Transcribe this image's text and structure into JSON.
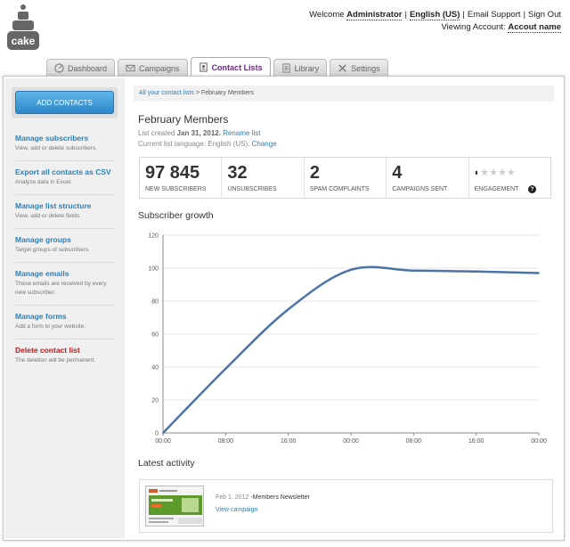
{
  "header": {
    "welcome_prefix": "Welcome",
    "user": "Administrator",
    "language": "English (US)",
    "support": "Email Support",
    "signout": "Sign Out",
    "viewing_prefix": "Viewing Account:",
    "account_name": "Accout name",
    "logo_text": "cake"
  },
  "tabs": [
    {
      "label": "Dashboard",
      "icon": "dashboard-icon"
    },
    {
      "label": "Campaigns",
      "icon": "envelope-icon"
    },
    {
      "label": "Contact Lists",
      "icon": "contact-book-icon",
      "active": true
    },
    {
      "label": "Library",
      "icon": "library-icon"
    },
    {
      "label": "Settings",
      "icon": "tools-icon"
    }
  ],
  "sidebar": {
    "add_button": "ADD CONTACTS",
    "items": [
      {
        "title": "Manage subscribers",
        "desc": "View, add or delete subscribers."
      },
      {
        "title": "Export all contacts as CSV",
        "desc": "Analyze data in Excel."
      },
      {
        "title": "Manage list structure",
        "desc": "View, add or delete fields."
      },
      {
        "title": "Manage groups",
        "desc": "Target groups of subscribers."
      },
      {
        "title": "Manage emails",
        "desc": "These emails are received by every new subscriber."
      },
      {
        "title": "Manage forms",
        "desc": "Add a form to your website."
      },
      {
        "title": "Delete contact list",
        "desc": "The deletion will be permanent.",
        "danger": true
      }
    ]
  },
  "breadcrumb": {
    "root": "All your contact lists",
    "sep": ">",
    "current": "February Members"
  },
  "list": {
    "title": "February Members",
    "created_prefix": "List created",
    "created_date": "Jan 31, 2012.",
    "rename": "Rename list",
    "language_prefix": "Current list language: English (US).",
    "change": "Change"
  },
  "stats": [
    {
      "value": "97 845",
      "label": "NEW SUBSCRIBERS"
    },
    {
      "value": "32",
      "label": "UNSUBSCRIBES"
    },
    {
      "value": "2",
      "label": "SPAM COMPLAINTS"
    },
    {
      "value": "4",
      "label": "CAMPAIGNS SENT"
    }
  ],
  "engagement": {
    "label": "ENGAGEMENT",
    "rating": 0.5,
    "max": 5,
    "help": "?"
  },
  "growth_title": "Subscriber growth",
  "chart_data": {
    "type": "line",
    "title": "Subscriber growth",
    "x": [
      "00:00",
      "08:00",
      "16:00",
      "00:00",
      "08:00",
      "16:00",
      "00:00"
    ],
    "series": [
      {
        "values": [
          0,
          39,
          75,
          99,
          98.5,
          98,
          97
        ]
      }
    ],
    "ylim": [
      0,
      120
    ],
    "yticks": [
      0,
      20,
      40,
      60,
      80,
      100,
      120
    ],
    "grid": true,
    "color": "#4a74a8"
  },
  "activity": {
    "title": "Latest activity",
    "date": "Feb 1, 2012",
    "name": "-Members Newsletter",
    "link": "View campaign"
  }
}
